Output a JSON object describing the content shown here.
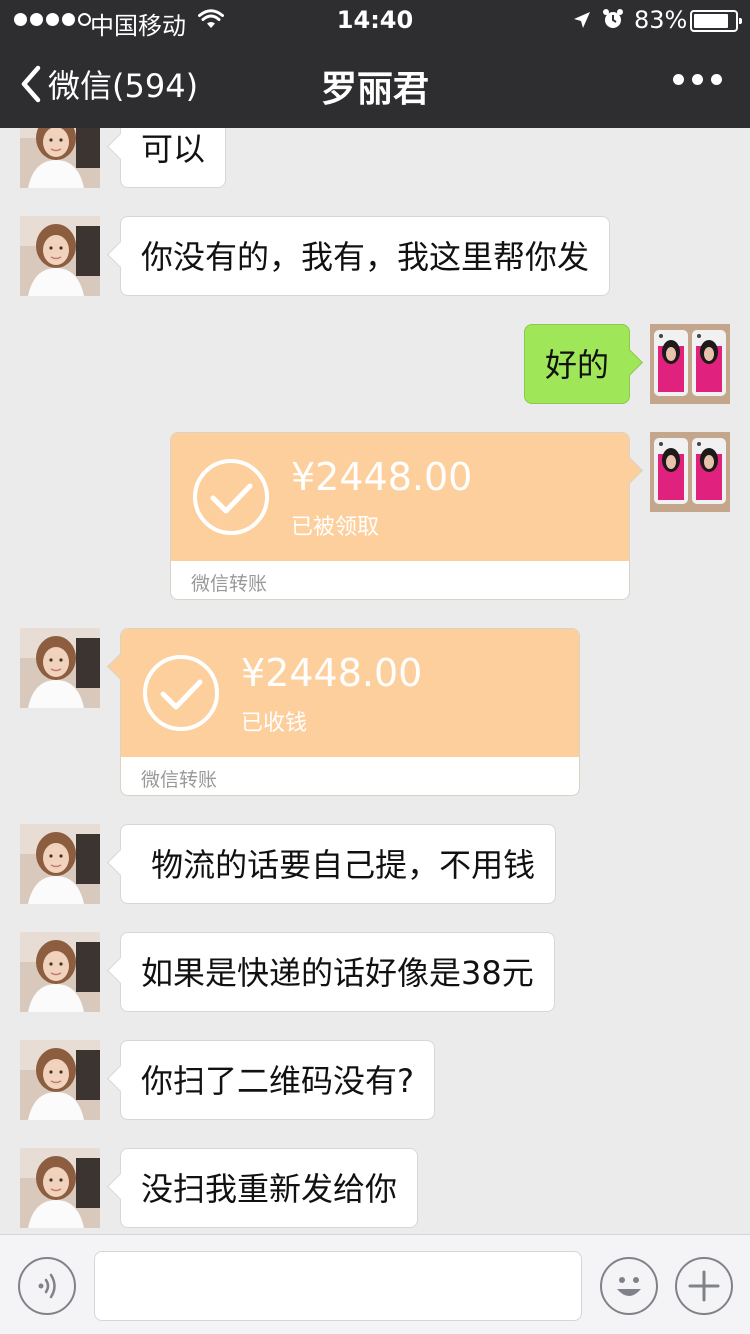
{
  "status_bar": {
    "carrier": "中国移动",
    "time": "14:40",
    "battery": "83%"
  },
  "nav": {
    "back_label": "微信(594)",
    "title": "罗丽君"
  },
  "messages": [
    {
      "from": "contact",
      "type": "text",
      "text": "可以"
    },
    {
      "from": "contact",
      "type": "text",
      "text": "你没有的，我有，我这里帮你发"
    },
    {
      "from": "me",
      "type": "text",
      "text": "好的"
    },
    {
      "from": "me",
      "type": "transfer",
      "amount": "¥2448.00",
      "status": "已被领取",
      "label": "微信转账"
    },
    {
      "from": "contact",
      "type": "transfer",
      "amount": "¥2448.00",
      "status": "已收钱",
      "label": "微信转账"
    },
    {
      "from": "contact",
      "type": "text",
      "text": " 物流的话要自己提，不用钱"
    },
    {
      "from": "contact",
      "type": "text",
      "text": "如果是快递的话好像是38元"
    },
    {
      "from": "contact",
      "type": "text",
      "text": "你扫了二维码没有?"
    },
    {
      "from": "contact",
      "type": "text",
      "text": "没扫我重新发给你"
    }
  ],
  "colors": {
    "navbar": "#2e2e30",
    "chat_bg": "#ebebeb",
    "sent_bubble": "#9fe658",
    "transfer_card": "#fdcf9d"
  },
  "icons": {
    "back": "chevron-left-icon",
    "more": "more-dots-icon",
    "voice": "voice-icon",
    "emoji": "emoji-icon",
    "plus": "plus-icon",
    "transfer_check": "check-circle-icon"
  }
}
